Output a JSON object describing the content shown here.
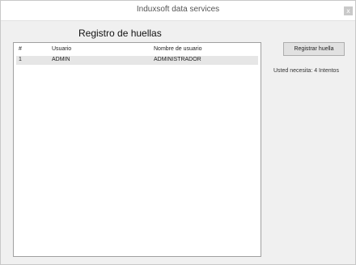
{
  "window": {
    "title": "Induxsoft data services",
    "close_glyph": "x"
  },
  "main": {
    "heading": "Registro de huellas",
    "table": {
      "columns": [
        "#",
        "Usuario",
        "Nombre de usuario"
      ],
      "rows": [
        {
          "num": "1",
          "usuario": "ADMIN",
          "nombre": "ADMINISTRADOR"
        }
      ]
    },
    "register_button": "Registrar huella",
    "status_text": "Usted necesita: 4 Intentos"
  }
}
